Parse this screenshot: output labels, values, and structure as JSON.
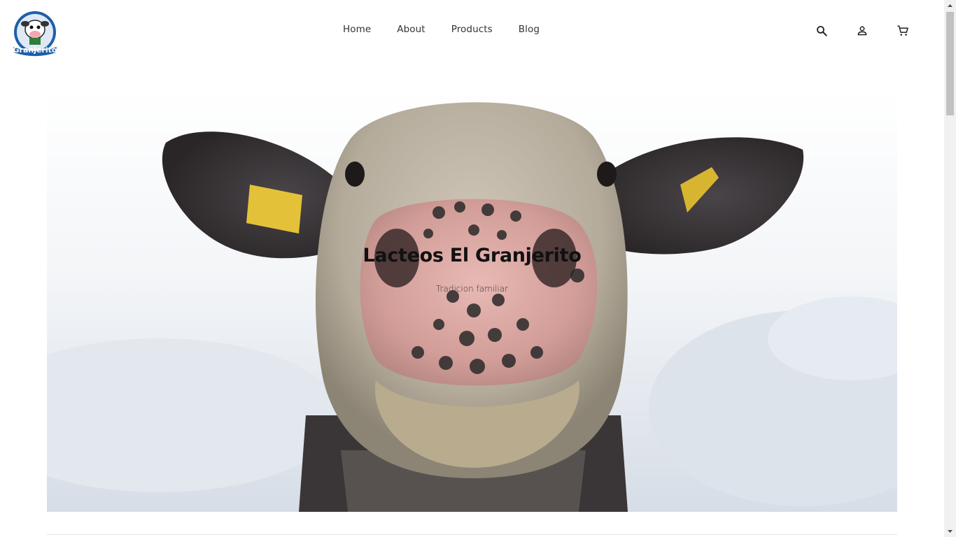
{
  "brand": {
    "name": "Granjerito",
    "logo_icon": "cow-mascot-logo"
  },
  "nav": {
    "items": [
      {
        "label": "Home"
      },
      {
        "label": "About"
      },
      {
        "label": "Products"
      },
      {
        "label": "Blog"
      }
    ]
  },
  "header_icons": [
    {
      "icon": "search-icon"
    },
    {
      "icon": "user-icon"
    },
    {
      "icon": "cart-icon"
    }
  ],
  "hero": {
    "title": "Lacteos El Granjerito",
    "subtitle": "Tradicion familiar",
    "image": "cow-closeup-photo"
  },
  "colors": {
    "logo_blue": "#1f5fa8",
    "text": "#222222",
    "sky": "#e9eef4"
  }
}
